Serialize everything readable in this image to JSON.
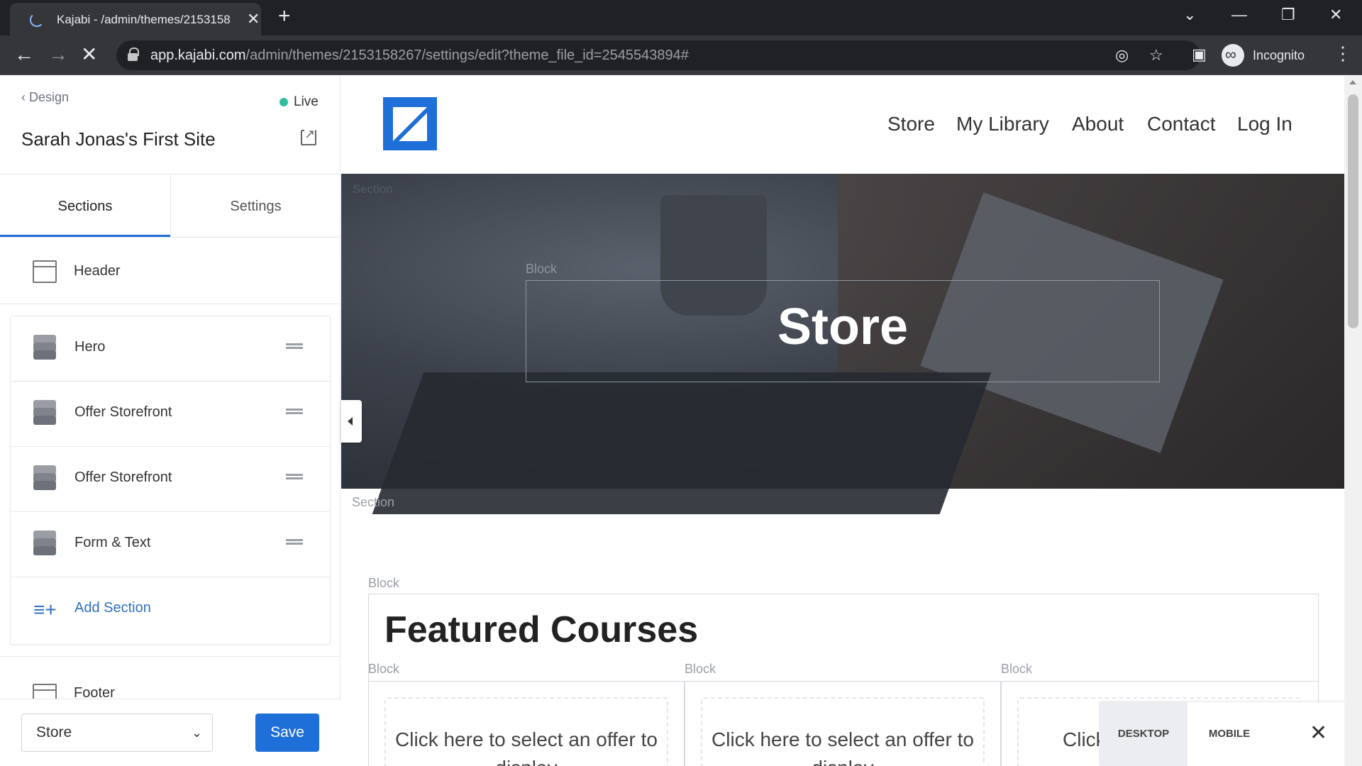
{
  "browser": {
    "tab_title": "Kajabi - /admin/themes/2153158",
    "tab_close": "✕",
    "new_tab": "+",
    "url_host": "app.kajabi.com",
    "url_path": "/admin/themes/2153158267/settings/edit?theme_file_id=2545543894#",
    "incognito_label": "Incognito"
  },
  "editor": {
    "back_label": "Design",
    "status": "Live",
    "site_title": "Sarah Jonas's First Site",
    "tabs": [
      "Sections",
      "Settings"
    ],
    "header_label": "Header",
    "sections": [
      "Hero",
      "Offer Storefront",
      "Offer Storefront",
      "Form & Text"
    ],
    "add_section_label": "Add Section",
    "footer_label": "Footer",
    "page_select_value": "Store",
    "save_label": "Save"
  },
  "preview": {
    "nav": [
      "Store",
      "My Library",
      "About",
      "Contact",
      "Log In"
    ],
    "section_label": "Section",
    "block_label": "Block",
    "hero_title": "Store",
    "featured_title": "Featured Courses",
    "card_text": "Click here to select an offer to display",
    "card_text_partial": "Click",
    "device_desktop": "DESKTOP",
    "device_mobile": "MOBILE"
  },
  "colors": {
    "primary": "#1f6fd8",
    "live_dot": "#2fbf9b",
    "add_section": "#2f6fc4"
  }
}
